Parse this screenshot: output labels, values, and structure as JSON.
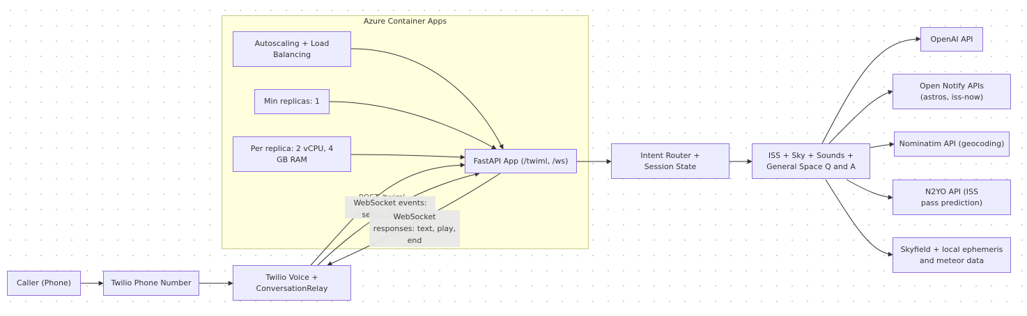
{
  "cluster": {
    "title": "Azure Container Apps"
  },
  "nodes": {
    "caller": "Caller (Phone)",
    "twilio_number": "Twilio Phone Number",
    "twilio_voice": "Twilio Voice + ConversationRelay",
    "autoscaling": "Autoscaling + Load Balancing",
    "min_replicas": "Min replicas: 1",
    "per_replica": "Per replica: 2 vCPU, 4 GB RAM",
    "fastapi": "FastAPI App (/twiml, /ws)",
    "intent_router": "Intent Router + Session State",
    "iss_sky": "ISS + Sky + Sounds + General Space Q and A",
    "openai": "OpenAI API",
    "open_notify": "Open Notify APIs (astros, iss-now)",
    "nominatim": "Nominatim API (geocoding)",
    "n2yo": "N2YO API (ISS pass prediction)",
    "skyfield": "Skyfield + local ephemeris and meteor data"
  },
  "edge_labels": {
    "post_twiml": "POST /twiml",
    "ws_events": "WebSocket events: setup, prompt, interrupt",
    "ws_responses": "WebSocket responses: text, play, end"
  },
  "colors": {
    "node_fill": "#ececff",
    "node_stroke": "#9370db",
    "cluster_fill": "#ffffde",
    "cluster_stroke": "#c9c98a",
    "edge": "#333333",
    "label_bg": "#e8e8e8"
  }
}
